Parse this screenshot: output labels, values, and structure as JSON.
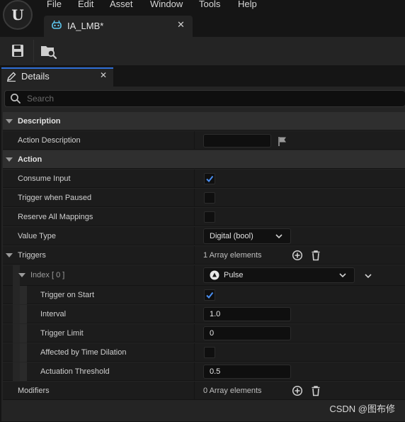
{
  "menu": [
    "File",
    "Edit",
    "Asset",
    "Window",
    "Tools",
    "Help"
  ],
  "asset_tab": {
    "label": "IA_LMB*"
  },
  "details_tab": {
    "label": "Details"
  },
  "search": {
    "placeholder": "Search"
  },
  "categories": {
    "description": "Description",
    "action": "Action"
  },
  "properties": {
    "action_description": {
      "label": "Action Description",
      "value": ""
    },
    "consume_input": {
      "label": "Consume Input",
      "checked": true
    },
    "trigger_when_paused": {
      "label": "Trigger when Paused",
      "checked": false
    },
    "reserve_all_mappings": {
      "label": "Reserve All Mappings",
      "checked": false
    },
    "value_type": {
      "label": "Value Type",
      "value": "Digital (bool)"
    },
    "triggers": {
      "label": "Triggers",
      "count": "1 Array elements"
    },
    "index0": {
      "label": "Index",
      "index": "[ 0 ]",
      "value": "Pulse"
    },
    "trigger_on_start": {
      "label": "Trigger on Start",
      "checked": true
    },
    "interval": {
      "label": "Interval",
      "value": "1.0"
    },
    "trigger_limit": {
      "label": "Trigger Limit",
      "value": "0"
    },
    "affected_by_time_dilation": {
      "label": "Affected by Time Dilation",
      "checked": false
    },
    "actuation_threshold": {
      "label": "Actuation Threshold",
      "value": "0.5"
    },
    "modifiers": {
      "label": "Modifiers",
      "count": "0 Array elements"
    }
  },
  "watermark": "CSDN @图布修",
  "colors": {
    "accent": "#2f6fd6",
    "panel": "#242424",
    "row": "#1c1c1c",
    "category": "#2f2f2f"
  }
}
